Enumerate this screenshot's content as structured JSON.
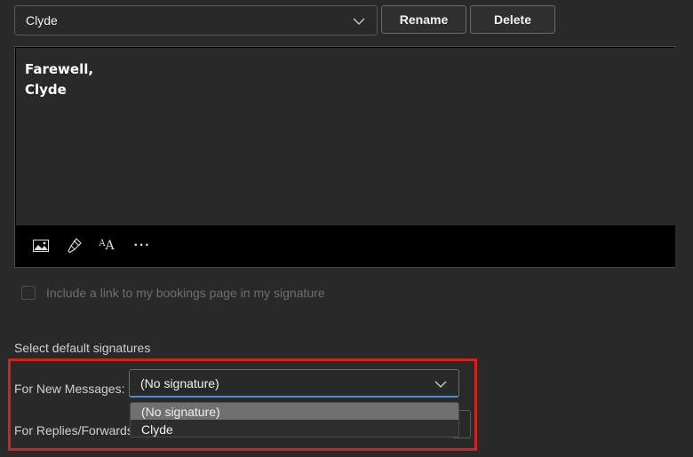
{
  "signature_selector": {
    "value": "Clyde",
    "icon": "chevron-down-icon"
  },
  "actions": {
    "rename_label": "Rename",
    "delete_label": "Delete"
  },
  "editor": {
    "line1": "Farewell,",
    "line2": "Clyde",
    "toolbar": {
      "icons": [
        "insert-image-icon",
        "format-painter-icon",
        "font-size-icon",
        "more-options-icon"
      ],
      "more_glyph": "···",
      "font_glyph": "AA"
    }
  },
  "bookings_checkbox": {
    "label": "Include a link to my bookings page in my signature",
    "checked": false
  },
  "defaults": {
    "title": "Select default signatures",
    "new_messages_label": "For New Messages:",
    "new_messages_value": "(No signature)",
    "replies_label": "For Replies/Forwards",
    "options": [
      "(No signature)",
      "Clyde"
    ]
  },
  "colors": {
    "highlight_border": "#d0231f",
    "focus_underline": "#4a8fd6",
    "selected_option_bg": "#707070"
  }
}
